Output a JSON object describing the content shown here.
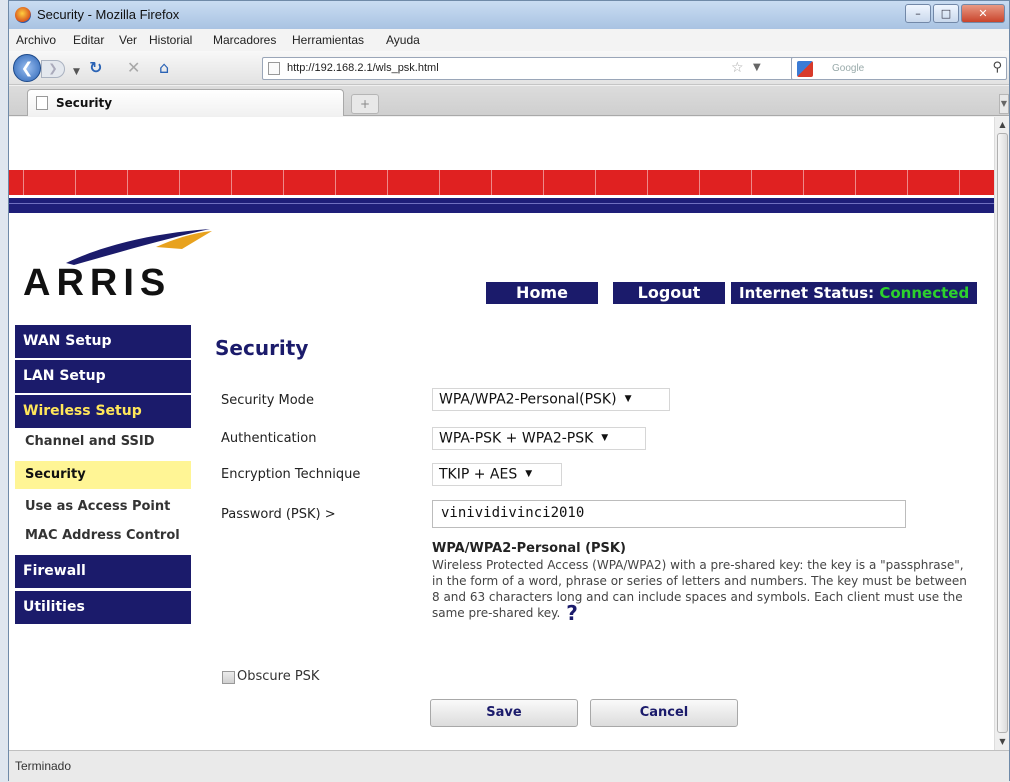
{
  "window": {
    "title": "Security - Mozilla Firefox"
  },
  "menu": [
    "Archivo",
    "Editar",
    "Ver",
    "Historial",
    "Marcadores",
    "Herramientas",
    "Ayuda"
  ],
  "nav": {
    "url": "http://192.168.2.1/wls_psk.html",
    "search_placeholder": "Google"
  },
  "tab": {
    "title": "Security",
    "new_tab": "+"
  },
  "router": {
    "logo_text": "ARRIS",
    "home_label": "Home",
    "logout_label": "Logout",
    "status_label": "Internet Status:",
    "status_value": "Connected",
    "status_color": "#2dd12d",
    "brand_color": "#1b1b6b",
    "band_color": "#e02121"
  },
  "sidebar": {
    "wan": "WAN Setup",
    "lan": "LAN Setup",
    "wireless": "Wireless Setup",
    "channel": "Channel and SSID",
    "security": "Security",
    "access_point": "Use as Access Point",
    "mac": "MAC Address Control",
    "firewall": "Firewall",
    "utilities": "Utilities"
  },
  "form": {
    "title": "Security",
    "mode_label": "Security Mode",
    "mode_value": "WPA/WPA2-Personal(PSK)",
    "auth_label": "Authentication",
    "auth_value": "WPA-PSK + WPA2-PSK",
    "enc_label": "Encryption Technique",
    "enc_value": "TKIP + AES",
    "psk_label": "Password (PSK) >",
    "psk_value": "vinividivinci2010",
    "help_title": "WPA/WPA2-Personal (PSK)",
    "help_text": "Wireless Protected Access (WPA/WPA2) with a pre-shared key: the key is a \"passphrase\", in the form of a word, phrase or series of letters and numbers. The key must be between 8 and 63 characters long and can include spaces and symbols. Each client must use the same pre-shared key.",
    "help_icon": "?",
    "obscure_label": "Obscure PSK",
    "save_label": "Save",
    "cancel_label": "Cancel"
  },
  "status_bar": {
    "text": "Terminado"
  }
}
